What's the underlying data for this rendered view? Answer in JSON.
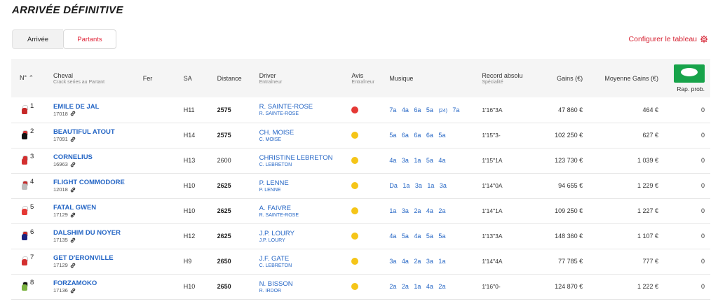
{
  "page_title": "ARRIVÉE DÉFINITIVE",
  "tabs": [
    {
      "label": "Arrivée",
      "active": true
    },
    {
      "label": "Partants",
      "active": false
    }
  ],
  "configure_label": "Configurer le tableau",
  "headers": {
    "num": "N°",
    "sort_icon": "^",
    "cheval": "Cheval",
    "cheval_sub": "Crack series au Partant",
    "fer": "Fer",
    "sa": "SA",
    "distance": "Distance",
    "driver": "Driver",
    "driver_sub": "Entraîneur",
    "avis": "Avis",
    "avis_sub": "Entraîneur",
    "musique": "Musique",
    "record": "Record absolu",
    "record_sub": "Spécialité",
    "gains": "Gains (€)",
    "moyenne": "Moyenne Gains (€)",
    "rap": "Rap. prob."
  },
  "rows": [
    {
      "num": "1",
      "name": "EMILE DE JAL",
      "id": "17018",
      "silk_body": "#c62828",
      "silk_cap": "#fff",
      "sa": "H11",
      "distance": "2575",
      "dist_bold": true,
      "driver": "R. SAINTE-ROSE",
      "trainer": "R. SAINTE-ROSE",
      "avis_color": "#e53935",
      "musique": "7a 4a 6a 5a",
      "musique_year": "(24)",
      "musique_tail": "7a",
      "record": "1'16\"3",
      "spec": "A",
      "gains": "47 860 €",
      "moyenne": "464 €",
      "rap": "0"
    },
    {
      "num": "2",
      "name": "BEAUTIFUL ATOUT",
      "id": "17091",
      "silk_body": "#111111",
      "silk_cap": "#d32f2f",
      "sa": "H14",
      "distance": "2575",
      "dist_bold": true,
      "driver": "CH. MOISE",
      "trainer": "C. MOISE",
      "avis_color": "#f5c518",
      "musique": "5a 6a 6a 6a 5a",
      "musique_year": "",
      "musique_tail": "",
      "record": "1'15\"3",
      "spec": "-",
      "gains": "102 250 €",
      "moyenne": "627 €",
      "rap": "0"
    },
    {
      "num": "3",
      "name": "CORNELIUS",
      "id": "16963",
      "silk_body": "#d32f2f",
      "silk_cap": "#d32f2f",
      "sa": "H13",
      "distance": "2600",
      "dist_bold": false,
      "driver": "CHRISTINE LEBRETON",
      "trainer": "C. LEBRETON",
      "avis_color": "#f5c518",
      "musique": "4a 3a 1a 5a 4a",
      "musique_year": "",
      "musique_tail": "",
      "record": "1'15\"1",
      "spec": "A",
      "gains": "123 730 €",
      "moyenne": "1 039 €",
      "rap": "0"
    },
    {
      "num": "4",
      "name": "FLIGHT COMMODORE",
      "id": "12018",
      "silk_body": "#bdbdbd",
      "silk_cap": "#c62828",
      "sa": "H10",
      "distance": "2625",
      "dist_bold": true,
      "driver": "P. LENNE",
      "trainer": "P. LENNE",
      "avis_color": "#f5c518",
      "musique": "Da 1a 3a 1a 3a",
      "musique_year": "",
      "musique_tail": "",
      "record": "1'14\"0",
      "spec": "A",
      "gains": "94 655 €",
      "moyenne": "1 229 €",
      "rap": "0"
    },
    {
      "num": "5",
      "name": "FATAL GWEN",
      "id": "17129",
      "silk_body": "#e53935",
      "silk_cap": "#fff",
      "sa": "H10",
      "distance": "2625",
      "dist_bold": true,
      "driver": "A. FAIVRE",
      "trainer": "R. SAINTE-ROSE",
      "avis_color": "#f5c518",
      "musique": "1a 3a 2a 4a 2a",
      "musique_year": "",
      "musique_tail": "",
      "record": "1'14\"1",
      "spec": "A",
      "gains": "109 250 €",
      "moyenne": "1 227 €",
      "rap": "0"
    },
    {
      "num": "6",
      "name": "DALSHIM DU NOYER",
      "id": "17135",
      "silk_body": "#1a237e",
      "silk_cap": "#c62828",
      "sa": "H12",
      "distance": "2625",
      "dist_bold": true,
      "driver": "J.P. LOURY",
      "trainer": "J.P. LOURY",
      "avis_color": "#f5c518",
      "musique": "4a 5a 4a 5a 5a",
      "musique_year": "",
      "musique_tail": "",
      "record": "1'13\"3",
      "spec": "A",
      "gains": "148 360 €",
      "moyenne": "1 107 €",
      "rap": "0"
    },
    {
      "num": "7",
      "name": "GET D'ERONVILLE",
      "id": "17129",
      "silk_body": "#d32f2f",
      "silk_cap": "#fff",
      "sa": "H9",
      "distance": "2650",
      "dist_bold": true,
      "driver": "J.F. GATE",
      "trainer": "C. LEBRETON",
      "avis_color": "#f5c518",
      "musique": "3a 4a 2a 3a 1a",
      "musique_year": "",
      "musique_tail": "",
      "record": "1'14\"4",
      "spec": "A",
      "gains": "77 785 €",
      "moyenne": "777 €",
      "rap": "0"
    },
    {
      "num": "8",
      "name": "FORZAMOKO",
      "id": "17136",
      "silk_body": "#7cb342",
      "silk_cap": "#111111",
      "sa": "H10",
      "distance": "2650",
      "dist_bold": true,
      "driver": "N. BISSON",
      "trainer": "R. IRDOR",
      "avis_color": "#f5c518",
      "musique": "2a 2a 1a 4a 2a",
      "musique_year": "",
      "musique_tail": "",
      "record": "1'16\"0",
      "spec": "-",
      "gains": "124 870 €",
      "moyenne": "1 222 €",
      "rap": "0"
    }
  ]
}
